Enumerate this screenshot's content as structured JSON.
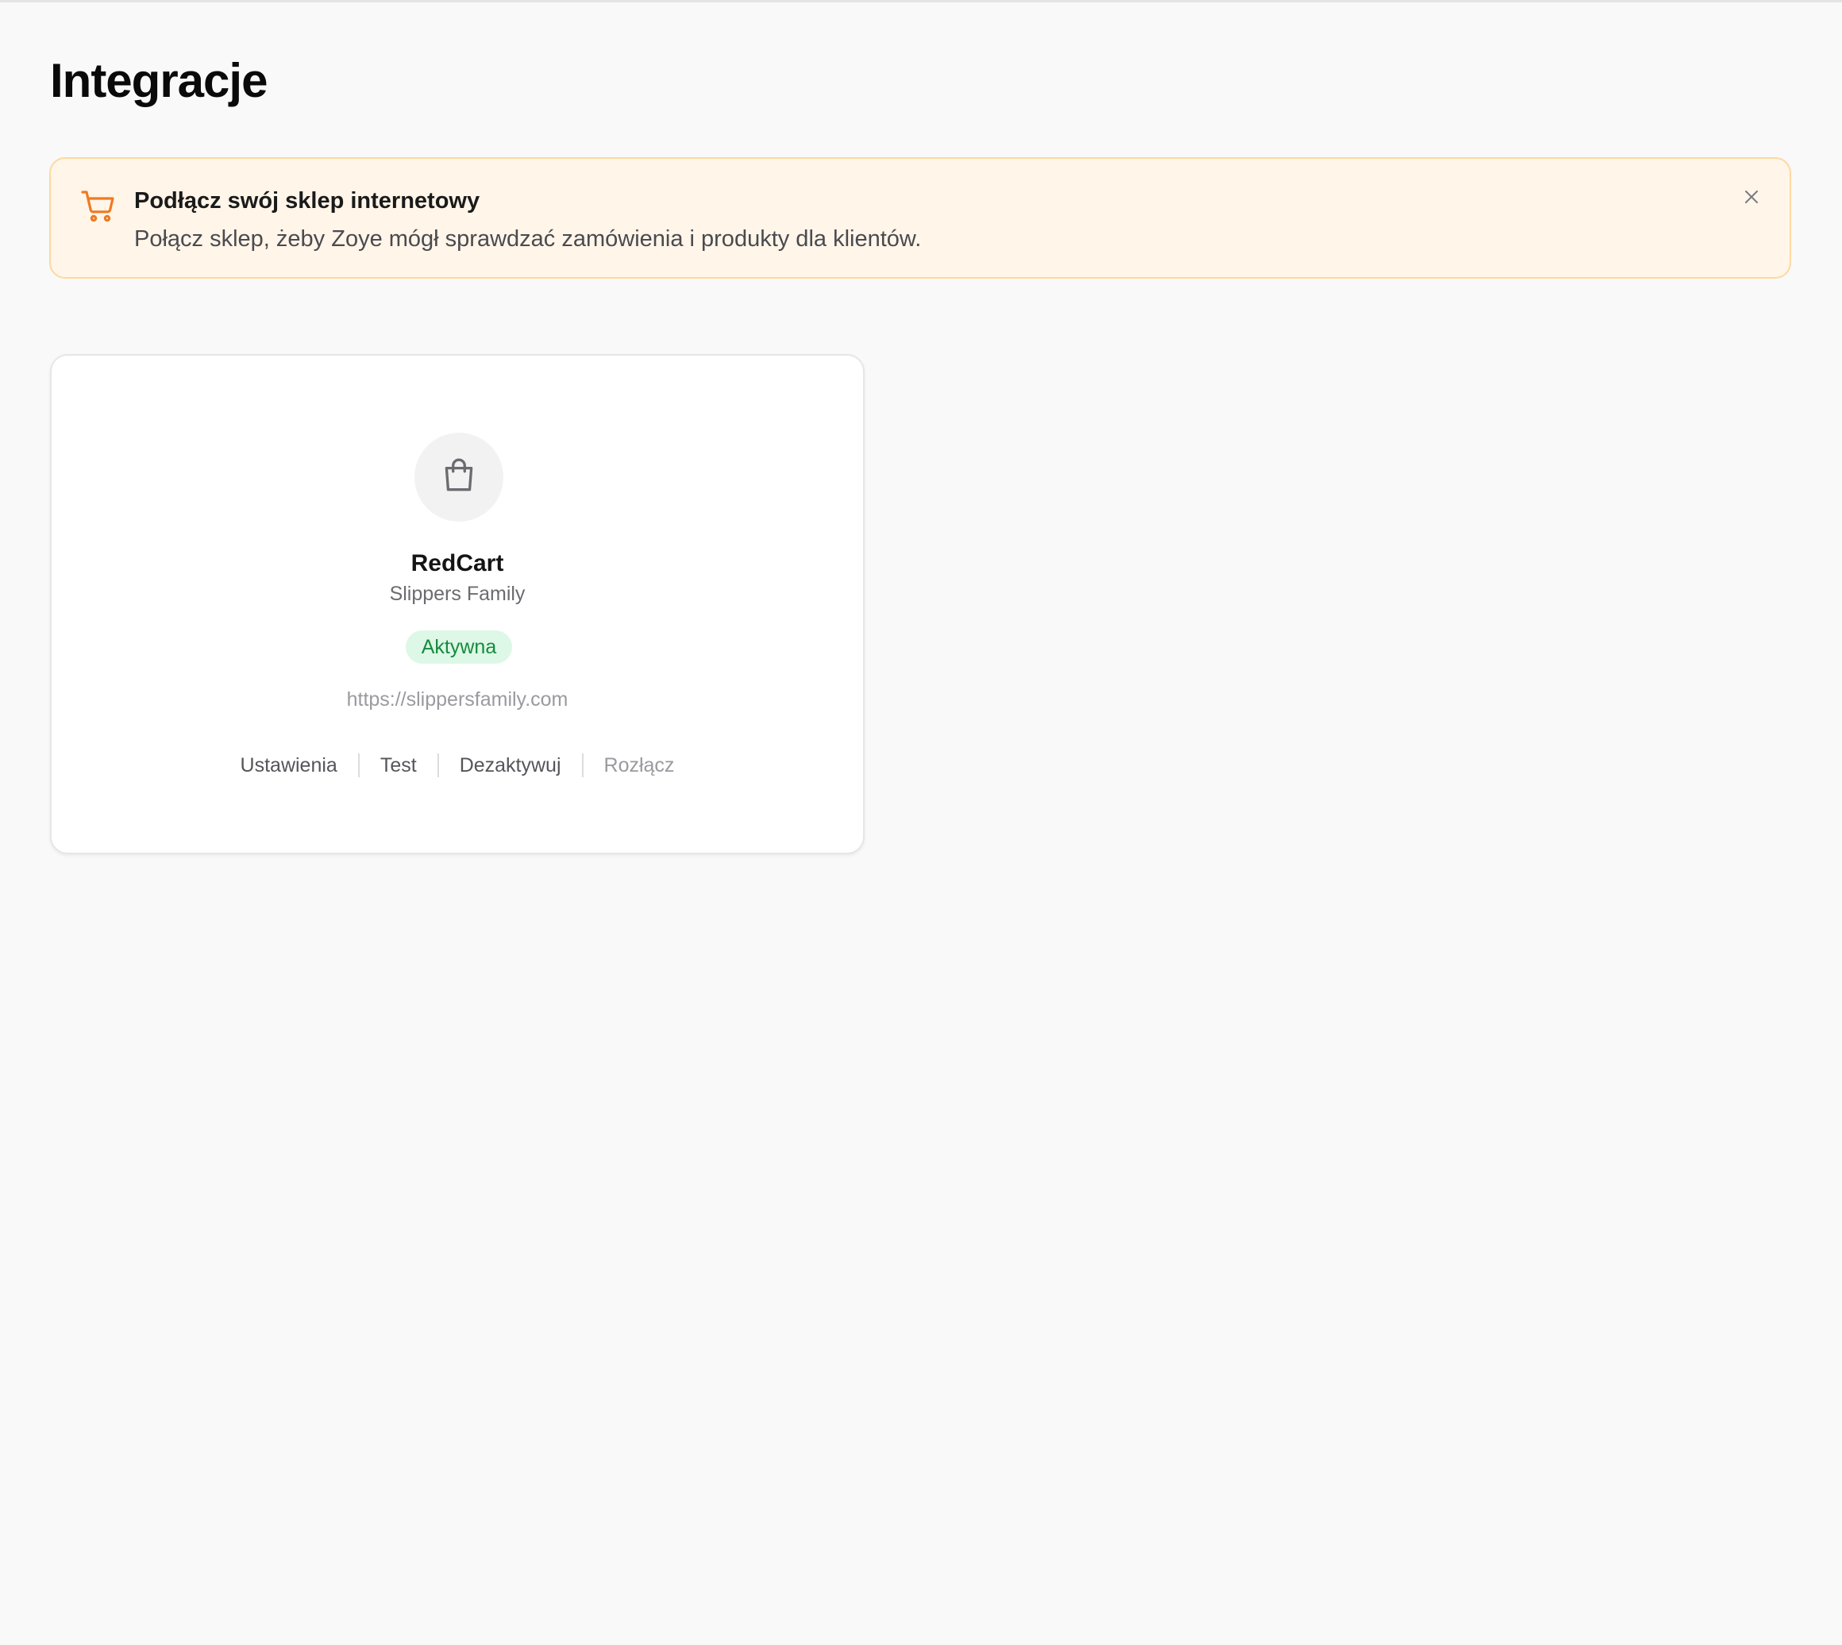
{
  "page": {
    "title": "Integracje"
  },
  "banner": {
    "icon": "shopping-cart-icon",
    "title": "Podłącz swój sklep internetowy",
    "text": "Połącz sklep, żeby Zoye mógł sprawdzać zamówienia i produkty dla klientów.",
    "close_icon": "close-icon",
    "accent": "#f07a1f"
  },
  "integration_card": {
    "icon": "shopping-bag-icon",
    "name": "RedCart",
    "store": "Slippers Family",
    "status": "Aktywna",
    "status_color": "#178a3f",
    "url": "https://slippersfamily.com",
    "actions": [
      {
        "label": "Ustawienia"
      },
      {
        "label": "Test"
      },
      {
        "label": "Dezaktywuj"
      },
      {
        "label": "Rozłącz"
      }
    ]
  }
}
